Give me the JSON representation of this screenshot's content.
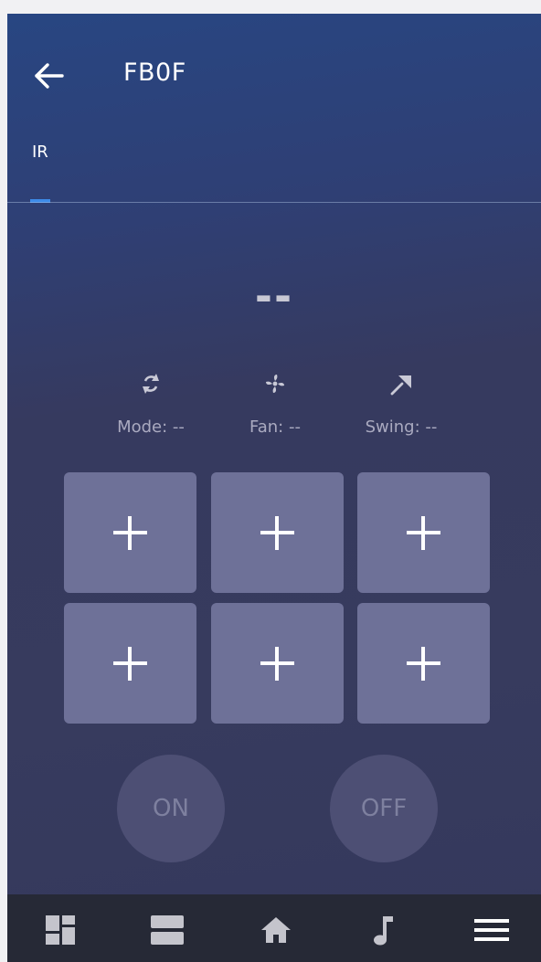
{
  "header": {
    "title": "FB0F",
    "back_icon": "arrow-left-icon"
  },
  "tabs": [
    {
      "label": "IR",
      "active": true
    }
  ],
  "colors": {
    "accent": "#3d8be9",
    "key_background": "#6e7198",
    "power_button": "#4d4f74",
    "nav_background": "#262936"
  },
  "display": {
    "temperature": "--"
  },
  "status": [
    {
      "icon": "mode-cycle-icon",
      "label": "Mode: --"
    },
    {
      "icon": "fan-icon",
      "label": "Fan: --"
    },
    {
      "icon": "swing-icon",
      "label": "Swing: --"
    }
  ],
  "keys": [
    {
      "icon": "plus-icon"
    },
    {
      "icon": "plus-icon"
    },
    {
      "icon": "plus-icon"
    },
    {
      "icon": "plus-icon"
    },
    {
      "icon": "plus-icon"
    },
    {
      "icon": "plus-icon"
    }
  ],
  "power": {
    "on_label": "ON",
    "off_label": "OFF"
  },
  "bottom_nav": [
    {
      "icon": "dashboard-icon"
    },
    {
      "icon": "rooms-icon"
    },
    {
      "icon": "home-icon"
    },
    {
      "icon": "music-note-icon"
    },
    {
      "icon": "menu-icon"
    }
  ]
}
